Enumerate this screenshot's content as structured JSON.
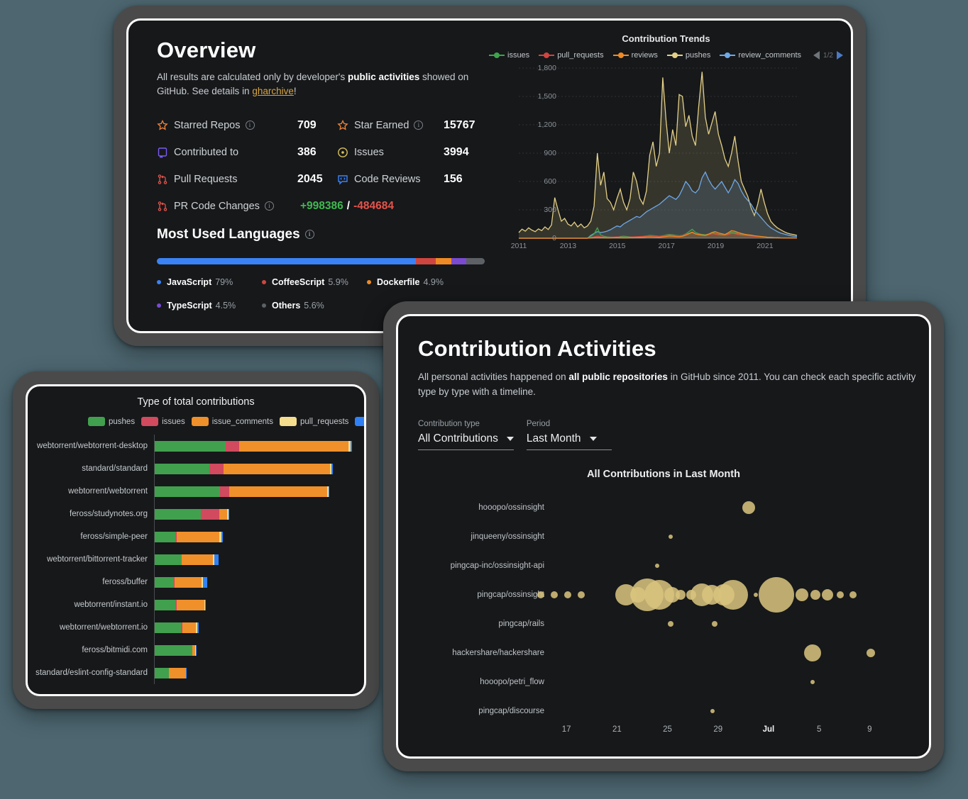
{
  "overview": {
    "title": "Overview",
    "subtitle_parts": {
      "a": "All results are calculated only by developer's ",
      "b": "public activities",
      "c": " showed on GitHub. See details in ",
      "d": "gharchive",
      "e": "!"
    },
    "stats": [
      {
        "icon": "star-icon",
        "label": "Starred Repos",
        "info": true,
        "value": "709",
        "icon_color": "#e8813a"
      },
      {
        "icon": "star-icon",
        "label": "Star Earned",
        "info": true,
        "value": "15767",
        "icon_color": "#e8813a"
      },
      {
        "icon": "repo-icon",
        "label": "Contributed to",
        "info": false,
        "value": "386",
        "icon_color": "#7a5af5"
      },
      {
        "icon": "issue-icon",
        "label": "Issues",
        "info": false,
        "value": "3994",
        "icon_color": "#d9c35c"
      },
      {
        "icon": "pull-request-icon",
        "label": "Pull Requests",
        "info": false,
        "value": "2045",
        "icon_color": "#e5534b"
      },
      {
        "icon": "code-review-icon",
        "label": "Code Reviews",
        "info": false,
        "value": "156",
        "icon_color": "#3b82f6"
      }
    ],
    "code_changes": {
      "icon": "pull-request-icon",
      "label": "PR Code Changes",
      "info": true,
      "additions": "+998386",
      "separator": "/",
      "deletions": "-484684",
      "add_color": "#3fb950",
      "del_color": "#e5534b"
    },
    "languages": {
      "title": "Most Used Languages",
      "info": true,
      "items": [
        {
          "name": "JavaScript",
          "pct": "79%",
          "share": 79.0,
          "color": "#3b82f6"
        },
        {
          "name": "CoffeeScript",
          "pct": "5.9%",
          "share": 5.9,
          "color": "#d0453f"
        },
        {
          "name": "Dockerfile",
          "pct": "4.9%",
          "share": 4.9,
          "color": "#f08a24"
        },
        {
          "name": "TypeScript",
          "pct": "4.5%",
          "share": 4.5,
          "color": "#7a4ad1"
        },
        {
          "name": "Others",
          "pct": "5.6%",
          "share": 5.6,
          "color": "#5d6166"
        }
      ]
    }
  },
  "trends_chart": {
    "title": "Contribution Trends",
    "pager": {
      "prev_icon": "chevron-left-icon",
      "text": "1/2",
      "next_icon": "chevron-right-icon"
    }
  },
  "bars_panel": {
    "title": "Type of total contributions"
  },
  "activities": {
    "title": "Contribution Activities",
    "desc_parts": {
      "a": "All personal activities happened on ",
      "b": "all public repositories",
      "c": " in GitHub since 2011. You can check each specific activity type by type with a timeline."
    },
    "filters": [
      {
        "label": "Contribution type",
        "value": "All Contributions",
        "icon": "chevron-down-icon"
      },
      {
        "label": "Period",
        "value": "Last Month",
        "icon": "chevron-down-icon"
      }
    ]
  },
  "chart_data": [
    {
      "type": "area",
      "title": "Contribution Trends",
      "xlabel": "",
      "ylabel": "",
      "ylim": [
        0,
        1800
      ],
      "yticks": [
        0,
        300,
        600,
        900,
        1200,
        1500,
        1800
      ],
      "yticklabels": [
        "0",
        "300",
        "600",
        "900",
        "1,200",
        "1,500",
        "1,800"
      ],
      "xticks": [
        2011,
        2013,
        2015,
        2017,
        2019,
        2021
      ],
      "xticklabels": [
        "2011",
        "2013",
        "2015",
        "2017",
        "2019",
        "2021"
      ],
      "grid": true,
      "legend_position": "top",
      "series": [
        {
          "name": "issues",
          "color": "#3fa34d",
          "values": [
            0,
            0,
            0,
            0,
            0,
            0,
            0,
            0,
            0,
            0,
            0,
            0,
            0,
            0,
            0,
            0,
            0,
            0,
            0,
            0,
            0,
            0,
            20,
            45,
            110,
            35,
            20,
            15,
            12,
            10,
            10,
            18,
            22,
            18,
            14,
            12,
            10,
            10,
            15,
            25,
            30,
            28,
            24,
            20,
            26,
            34,
            40,
            36,
            30,
            26,
            30,
            45,
            70,
            95,
            62,
            48,
            40,
            36,
            44,
            60,
            52,
            42,
            38,
            34,
            46,
            64,
            58,
            46,
            40,
            34,
            30,
            28,
            24,
            20,
            18,
            14,
            10,
            8,
            6,
            5,
            4,
            3,
            2,
            2,
            2,
            2
          ]
        },
        {
          "name": "pull_requests",
          "color": "#d0453f",
          "values": [
            0,
            0,
            0,
            0,
            0,
            0,
            0,
            0,
            0,
            0,
            0,
            0,
            0,
            0,
            0,
            0,
            0,
            0,
            0,
            0,
            0,
            0,
            8,
            14,
            22,
            16,
            12,
            10,
            10,
            12,
            14,
            12,
            10,
            10,
            12,
            14,
            16,
            18,
            20,
            24,
            26,
            24,
            22,
            20,
            24,
            28,
            32,
            30,
            26,
            24,
            28,
            40,
            52,
            60,
            44,
            36,
            32,
            30,
            38,
            48,
            44,
            36,
            32,
            30,
            40,
            52,
            48,
            40,
            34,
            30,
            26,
            24,
            20,
            18,
            16,
            12,
            10,
            8,
            6,
            5,
            4,
            3,
            3,
            2,
            2,
            2
          ]
        },
        {
          "name": "reviews",
          "color": "#f08a24",
          "values": [
            0,
            0,
            0,
            0,
            0,
            0,
            0,
            0,
            0,
            0,
            0,
            0,
            0,
            0,
            0,
            0,
            0,
            0,
            0,
            0,
            0,
            0,
            3,
            5,
            8,
            6,
            5,
            4,
            4,
            5,
            6,
            5,
            4,
            4,
            6,
            7,
            8,
            9,
            10,
            12,
            14,
            12,
            11,
            10,
            14,
            18,
            24,
            22,
            18,
            16,
            20,
            32,
            48,
            64,
            46,
            38,
            34,
            30,
            42,
            60,
            70,
            56,
            48,
            40,
            58,
            80,
            74,
            60,
            50,
            42,
            36,
            32,
            26,
            22,
            18,
            14,
            10,
            8,
            6,
            5,
            4,
            3,
            3,
            2,
            2,
            2
          ]
        },
        {
          "name": "pushes",
          "color": "#e3cf87",
          "values": [
            60,
            96,
            74,
            110,
            86,
            70,
            98,
            80,
            120,
            92,
            140,
            430,
            300,
            180,
            210,
            150,
            130,
            170,
            120,
            150,
            110,
            130,
            180,
            340,
            900,
            560,
            700,
            420,
            380,
            300,
            420,
            520,
            380,
            300,
            420,
            700,
            600,
            420,
            360,
            500,
            880,
            1020,
            760,
            900,
            1700,
            1250,
            900,
            1150,
            980,
            1520,
            1500,
            1180,
            1300,
            1080,
            980,
            1400,
            1760,
            1280,
            1100,
            1220,
            1340,
            1100,
            980,
            840,
            760,
            900,
            1080,
            820,
            600,
            520,
            440,
            320,
            240,
            360,
            520,
            380,
            260,
            180,
            140,
            110,
            90,
            70,
            55,
            45,
            38,
            30
          ]
        },
        {
          "name": "review_comments",
          "color": "#6ea8e8",
          "values": [
            0,
            0,
            0,
            0,
            0,
            0,
            0,
            0,
            0,
            0,
            0,
            0,
            0,
            0,
            0,
            0,
            0,
            0,
            0,
            0,
            0,
            0,
            30,
            50,
            70,
            60,
            65,
            75,
            90,
            110,
            130,
            120,
            150,
            170,
            190,
            210,
            230,
            220,
            250,
            280,
            300,
            320,
            340,
            360,
            390,
            420,
            450,
            430,
            410,
            450,
            520,
            600,
            560,
            500,
            480,
            520,
            640,
            700,
            620,
            560,
            520,
            560,
            600,
            540,
            480,
            540,
            620,
            580,
            500,
            440,
            400,
            360,
            300,
            260,
            220,
            180,
            140,
            110,
            90,
            70,
            55,
            45,
            35,
            28,
            22,
            18
          ]
        }
      ]
    },
    {
      "type": "bar",
      "orientation": "horizontal",
      "stacked": true,
      "title": "Type of total contributions",
      "categories": [
        "webtorrent/webtorrent-desktop",
        "standard/standard",
        "webtorrent/webtorrent",
        "feross/studynotes.org",
        "feross/simple-peer",
        "webtorrent/bittorrent-tracker",
        "feross/buffer",
        "webtorrent/instant.io",
        "webtorrent/webtorrent.io",
        "feross/bitmidi.com",
        "standard/eslint-config-standard"
      ],
      "legend": [
        {
          "name": "pushes",
          "color": "#41a04e"
        },
        {
          "name": "issues",
          "color": "#d14a5e"
        },
        {
          "name": "issue_comments",
          "color": "#f0902a"
        },
        {
          "name": "pull_requests",
          "color": "#f5dd8e"
        },
        {
          "name": "reviews",
          "color": "#2f81f7"
        }
      ],
      "xlim": [
        0,
        1500
      ],
      "series": [
        {
          "name": "pushes",
          "values": [
            510,
            395,
            470,
            335,
            150,
            197,
            142,
            150,
            192,
            273,
            105
          ]
        },
        {
          "name": "issues",
          "values": [
            100,
            100,
            65,
            133,
            12,
            2,
            3,
            11,
            10,
            2,
            3
          ]
        },
        {
          "name": "issue_comments",
          "values": [
            780,
            760,
            700,
            55,
            303,
            222,
            197,
            198,
            97,
            21,
            120
          ]
        },
        {
          "name": "pull_requests",
          "values": [
            16,
            14,
            12,
            8,
            16,
            8,
            10,
            5,
            11,
            3,
            2
          ]
        },
        {
          "name": "reviews",
          "values": [
            8,
            7,
            5,
            2,
            13,
            32,
            27,
            1,
            10,
            1,
            4
          ]
        }
      ]
    },
    {
      "type": "scatter",
      "bubble": true,
      "title": "All Contributions in Last Month",
      "ylabel": "",
      "xlabel": "",
      "categories": [
        "hooopo/ossinsight",
        "jinqueeny/ossinsight",
        "pingcap-inc/ossinsight-api",
        "pingcap/ossinsight",
        "pingcap/rails",
        "hackershare/hackershare",
        "hooopo/petri_flow",
        "pingcap/discourse"
      ],
      "xticks": [
        "17",
        "21",
        "25",
        "29",
        "Jul",
        "5",
        "9"
      ],
      "xtick_bold": "Jul",
      "bubble_color": "#d9c47e",
      "points": [
        {
          "row": "hooopo/ossinsight",
          "x": 0.554,
          "r": 9
        },
        {
          "row": "jinqueeny/ossinsight",
          "x": 0.348,
          "r": 3
        },
        {
          "row": "pingcap-inc/ossinsight-api",
          "x": 0.312,
          "r": 3
        },
        {
          "row": "pingcap/ossinsight",
          "x": 0.005,
          "r": 5
        },
        {
          "row": "pingcap/ossinsight",
          "x": 0.041,
          "r": 5
        },
        {
          "row": "pingcap/ossinsight",
          "x": 0.077,
          "r": 5
        },
        {
          "row": "pingcap/ossinsight",
          "x": 0.113,
          "r": 5
        },
        {
          "row": "pingcap/ossinsight",
          "x": 0.231,
          "r": 15
        },
        {
          "row": "pingcap/ossinsight",
          "x": 0.262,
          "r": 11
        },
        {
          "row": "pingcap/ossinsight",
          "x": 0.286,
          "r": 23
        },
        {
          "row": "pingcap/ossinsight",
          "x": 0.318,
          "r": 21
        },
        {
          "row": "pingcap/ossinsight",
          "x": 0.352,
          "r": 11
        },
        {
          "row": "pingcap/ossinsight",
          "x": 0.374,
          "r": 7
        },
        {
          "row": "pingcap/ossinsight",
          "x": 0.402,
          "r": 7
        },
        {
          "row": "pingcap/ossinsight",
          "x": 0.43,
          "r": 16
        },
        {
          "row": "pingcap/ossinsight",
          "x": 0.456,
          "r": 14
        },
        {
          "row": "pingcap/ossinsight",
          "x": 0.489,
          "r": 15
        },
        {
          "row": "pingcap/ossinsight",
          "x": 0.514,
          "r": 21
        },
        {
          "row": "pingcap/ossinsight",
          "x": 0.573,
          "r": 3
        },
        {
          "row": "pingcap/ossinsight",
          "x": 0.628,
          "r": 25
        },
        {
          "row": "pingcap/ossinsight",
          "x": 0.695,
          "r": 9
        },
        {
          "row": "pingcap/ossinsight",
          "x": 0.73,
          "r": 7
        },
        {
          "row": "pingcap/ossinsight",
          "x": 0.762,
          "r": 8
        },
        {
          "row": "pingcap/ossinsight",
          "x": 0.795,
          "r": 5
        },
        {
          "row": "pingcap/ossinsight",
          "x": 0.83,
          "r": 5
        },
        {
          "row": "pingcap/rails",
          "x": 0.348,
          "r": 4
        },
        {
          "row": "pingcap/rails",
          "x": 0.464,
          "r": 4
        },
        {
          "row": "hackershare/hackershare",
          "x": 0.723,
          "r": 12
        },
        {
          "row": "hackershare/hackershare",
          "x": 0.876,
          "r": 6
        },
        {
          "row": "hooopo/petri_flow",
          "x": 0.723,
          "r": 3
        },
        {
          "row": "pingcap/discourse",
          "x": 0.459,
          "r": 3
        }
      ]
    }
  ]
}
